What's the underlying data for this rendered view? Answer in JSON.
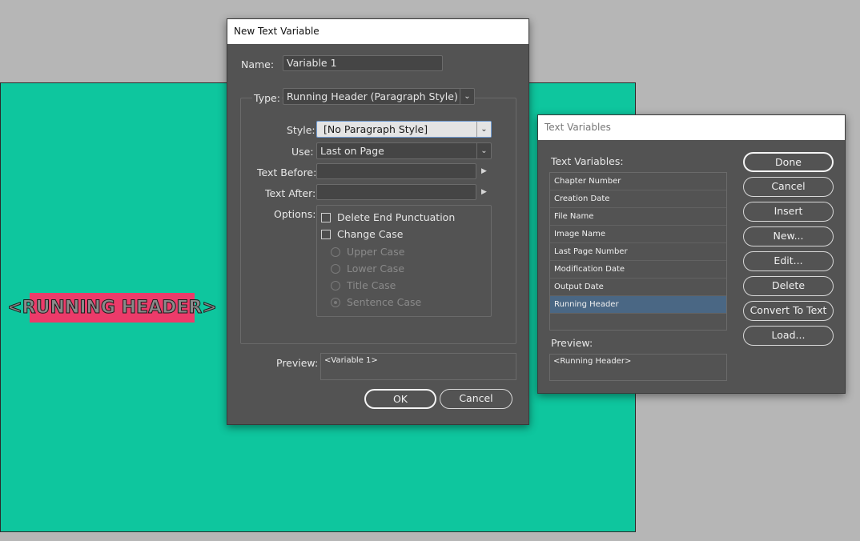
{
  "canvas": {
    "header_text": "<RUNNING HEADER>"
  },
  "new_var_dialog": {
    "title": "New Text Variable",
    "name_label": "Name:",
    "name_value": "Variable 1",
    "type_label": "Type:",
    "type_value": "Running Header (Paragraph Style)",
    "style_label": "Style:",
    "style_value": "[No Paragraph Style]",
    "use_label": "Use:",
    "use_value": "Last on Page",
    "text_before_label": "Text Before:",
    "text_before_value": "",
    "text_after_label": "Text After:",
    "text_after_value": "",
    "options_label": "Options:",
    "delete_end_punct": "Delete End Punctuation",
    "change_case": "Change Case",
    "upper_case": "Upper Case",
    "lower_case": "Lower Case",
    "title_case": "Title Case",
    "sentence_case": "Sentence Case",
    "preview_label": "Preview:",
    "preview_value": "<Variable 1>",
    "ok_label": "OK",
    "cancel_label": "Cancel"
  },
  "text_vars_dialog": {
    "title": "Text Variables",
    "list_label": "Text Variables:",
    "items": [
      "Chapter Number",
      "Creation Date",
      "File Name",
      "Image Name",
      "Last Page Number",
      "Modification Date",
      "Output Date",
      "Running Header"
    ],
    "selected": "Running Header",
    "preview_label": "Preview:",
    "preview_value": "<Running Header>",
    "buttons": {
      "done": "Done",
      "cancel": "Cancel",
      "insert": "Insert",
      "new": "New...",
      "edit": "Edit...",
      "delete": "Delete",
      "convert": "Convert To Text",
      "load": "Load..."
    }
  }
}
